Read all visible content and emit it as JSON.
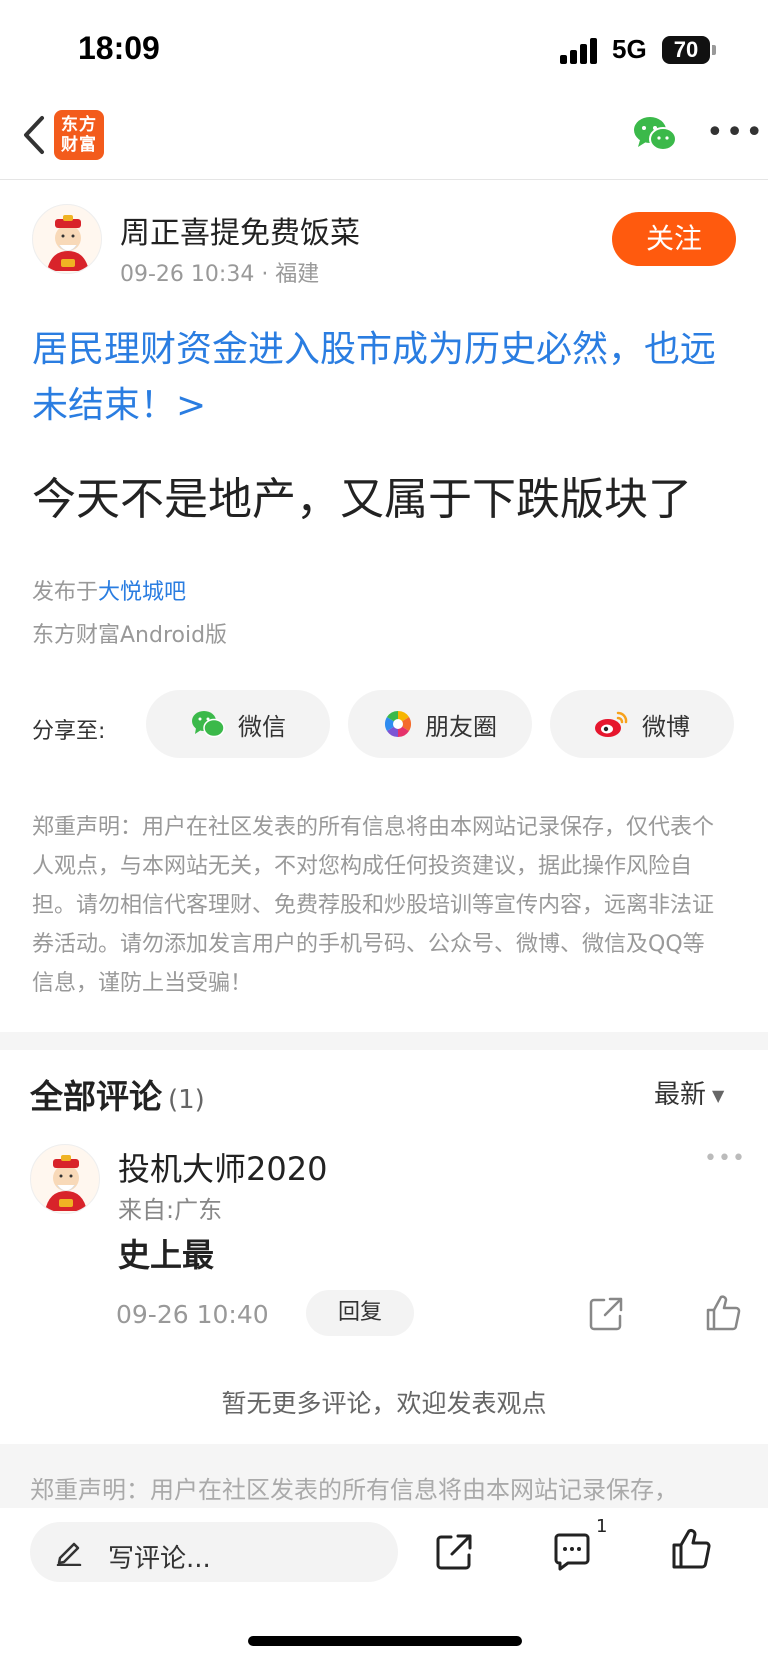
{
  "status_bar": {
    "time": "18:09",
    "network": "5G",
    "battery": "70"
  },
  "nav": {
    "logo_text_1": "东方",
    "logo_text_2": "财富"
  },
  "author": {
    "name": "周正喜提免费饭菜",
    "meta": "09-26 10:34 · 福建",
    "follow_label": "关注"
  },
  "post": {
    "topic_link": "居民理财资金进入股市成为历史必然，也远未结束！>",
    "text": "今天不是地产，又属于下跌版块了",
    "published_prefix": "发布于",
    "published_bar": "大悦城吧",
    "client": "东方财富Android版"
  },
  "share": {
    "label": "分享至:",
    "wechat": "微信",
    "moments": "朋友圈",
    "weibo": "微博"
  },
  "disclaimer": "郑重声明：用户在社区发表的所有信息将由本网站记录保存，仅代表个人观点，与本网站无关，不对您构成任何投资建议，据此操作风险自担。请勿相信代客理财、免费荐股和炒股培训等宣传内容，远离非法证券活动。请勿添加发言用户的手机号码、公众号、微博、微信及QQ等信息，谨防上当受骗！",
  "comments": {
    "title": "全部评论",
    "count": "(1)",
    "sort": "最新",
    "items": [
      {
        "name": "投机大师2020",
        "from": "来自:广东",
        "body": "史上最",
        "time": "09-26 10:40",
        "reply_label": "回复"
      }
    ],
    "no_more": "暂无更多评论，欢迎发表观点"
  },
  "footer_disclaimer": "郑重声明：用户在社区发表的所有信息将由本网站记录保存，",
  "bottom_bar": {
    "placeholder": "写评论...",
    "comment_badge": "1"
  },
  "colors": {
    "accent": "#ff5a0e",
    "link": "#2a7de1",
    "wechat_green": "#3bb94a",
    "weibo_red": "#e6162d"
  }
}
